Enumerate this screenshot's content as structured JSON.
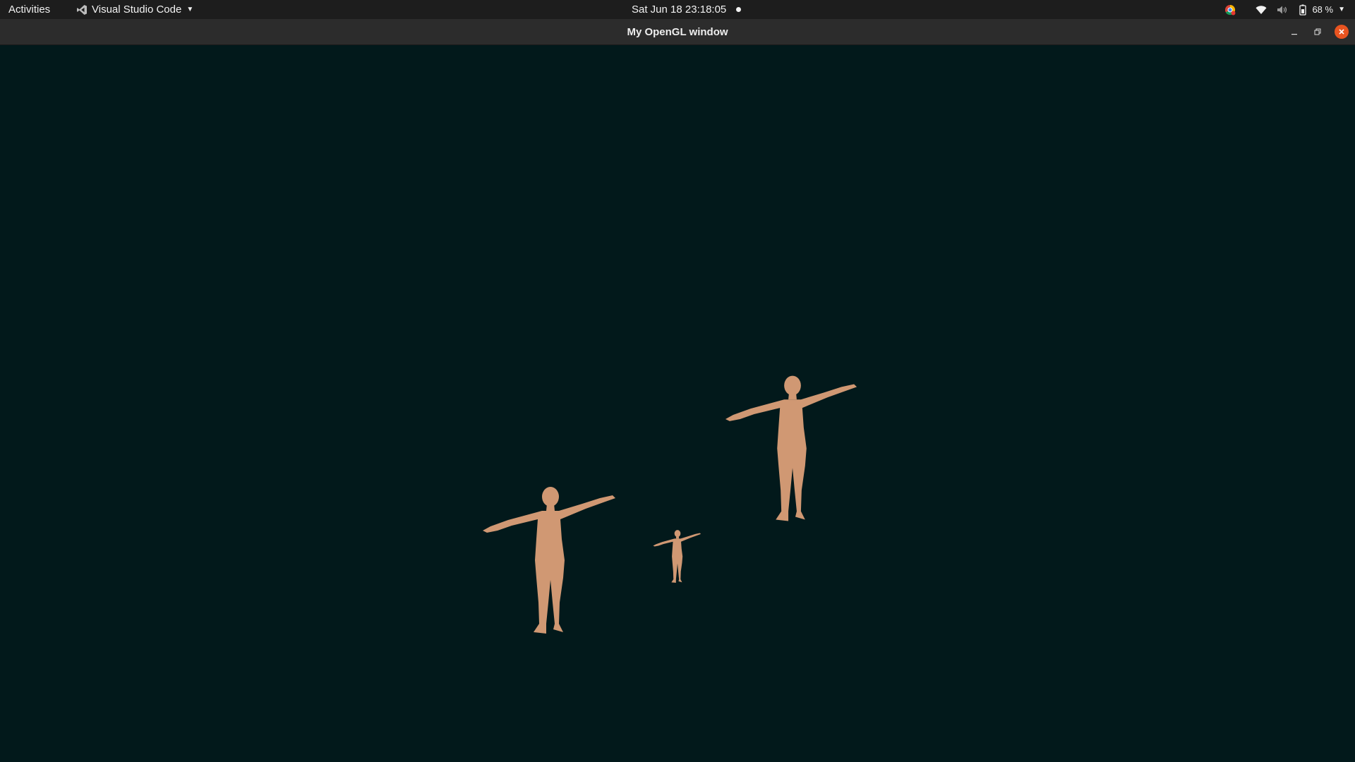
{
  "topbar": {
    "activities_label": "Activities",
    "app_name": "Visual Studio Code",
    "clock": "Sat Jun 18  23:18:05",
    "battery_percent": "68 %"
  },
  "window": {
    "title": "My OpenGL window"
  },
  "icons": {
    "app": "vscode-icon",
    "app_caret": "chevron-down-icon",
    "notification": "notification-dot-icon",
    "chrome": "chrome-icon",
    "wifi": "wifi-icon",
    "volume": "volume-icon",
    "battery": "battery-icon",
    "tray_caret": "chevron-down-icon",
    "minimize": "minimize-icon",
    "maximize": "restore-icon",
    "close": "close-icon"
  },
  "colors": {
    "background": "#02191b",
    "figure_skin": "#d09873",
    "topbar": "#1d1d1d",
    "titlebar": "#2c2c2c",
    "close_button": "#e95420"
  },
  "scene": {
    "figures": [
      "adult-female-figure",
      "child-figure",
      "adult-male-figure"
    ]
  }
}
